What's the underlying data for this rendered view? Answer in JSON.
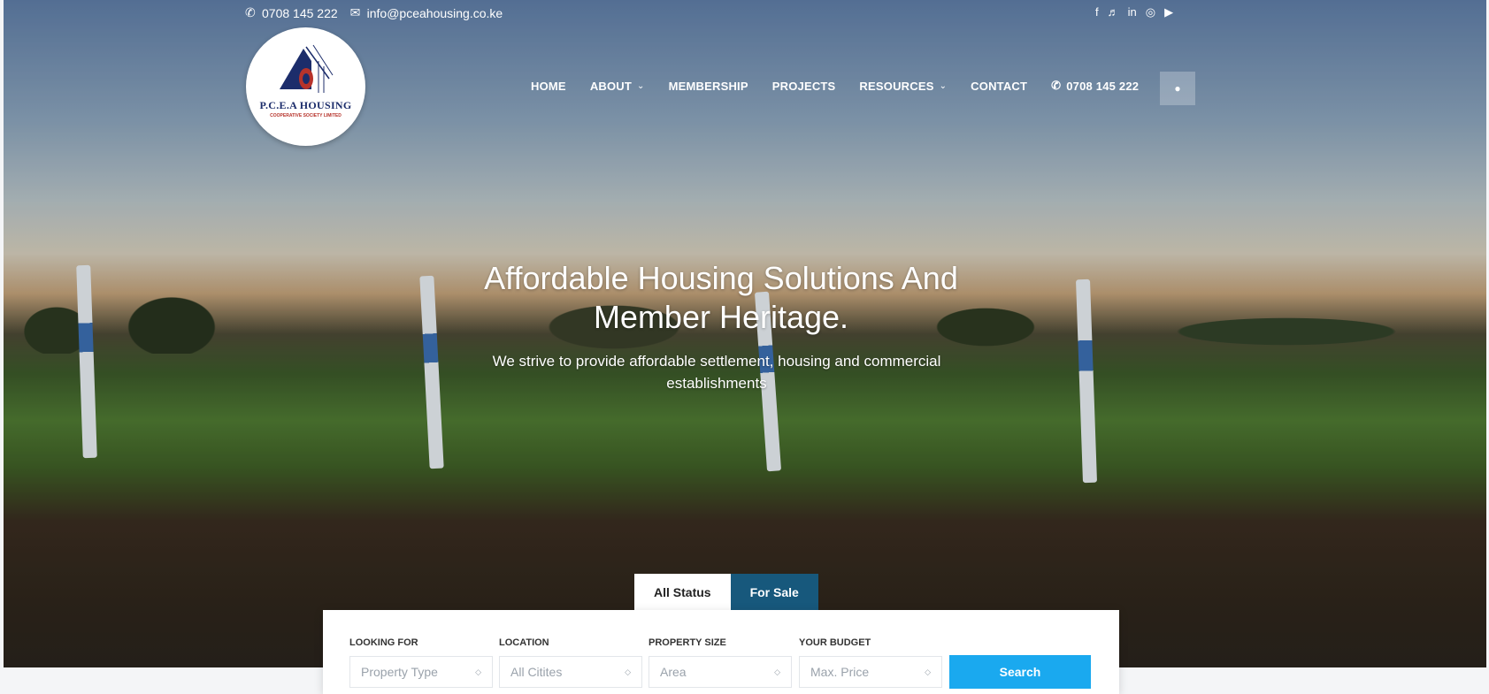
{
  "topbar": {
    "phone": "0708 145 222",
    "email": "info@pceahousing.co.ke",
    "social_icons": [
      "facebook-icon",
      "twitter-icon",
      "linkedin-icon",
      "instagram-icon",
      "youtube-icon"
    ]
  },
  "logo": {
    "name": "P.C.E.A HOUSING",
    "subname": "COOPERATIVE SOCIETY LIMITED"
  },
  "nav": {
    "items": [
      {
        "label": "HOME",
        "dropdown": false
      },
      {
        "label": "ABOUT",
        "dropdown": true
      },
      {
        "label": "MEMBERSHIP",
        "dropdown": false
      },
      {
        "label": "PROJECTS",
        "dropdown": false
      },
      {
        "label": "RESOURCES",
        "dropdown": true
      },
      {
        "label": "CONTACT",
        "dropdown": false
      }
    ],
    "phone": "0708 145 222"
  },
  "hero": {
    "headline_line1": "Affordable Housing Solutions And",
    "headline_line2": "Member Heritage.",
    "subline_line1": "We strive to provide affordable settlement, housing and commercial",
    "subline_line2": "establishments"
  },
  "search": {
    "tabs": [
      {
        "label": "All Status",
        "active": true
      },
      {
        "label": "For Sale",
        "active": false
      }
    ],
    "fields": [
      {
        "label": "LOOKING FOR",
        "value": "Property Type"
      },
      {
        "label": "LOCATION",
        "value": "All Citites"
      },
      {
        "label": "PROPERTY SIZE",
        "value": "Area"
      },
      {
        "label": "YOUR BUDGET",
        "value": "Max. Price"
      }
    ],
    "button_label": "Search"
  },
  "colors": {
    "search_button": "#1aa9ef",
    "tab_inactive": "#17587c",
    "logo_text": "#1c2d6b",
    "logo_accent": "#b7332b"
  }
}
